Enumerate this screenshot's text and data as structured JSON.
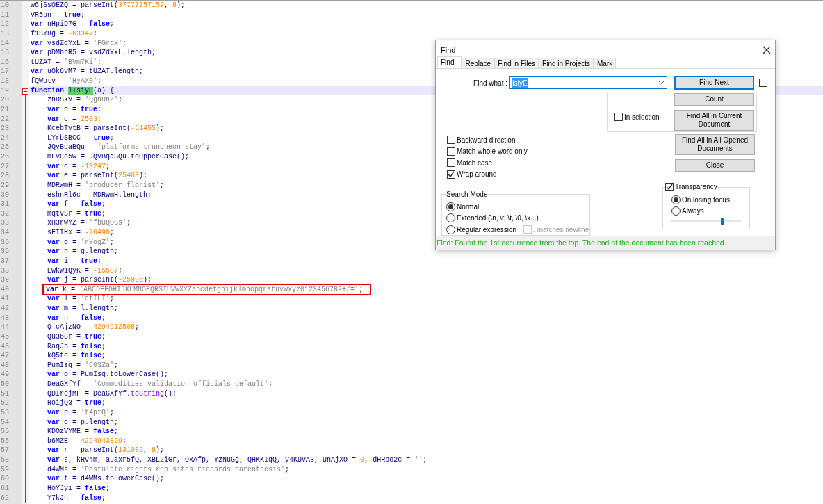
{
  "editor": {
    "lines": [
      {
        "no": "10",
        "current": false,
        "boxed": false,
        "tokens": [
          {
            "kind": "plain",
            "text": "w6jSsQEZQ = parseInt("
          },
          {
            "kind": "number",
            "text": "37777757152"
          },
          {
            "kind": "plain",
            "text": ", "
          },
          {
            "kind": "number",
            "text": "8"
          },
          {
            "kind": "plain",
            "text": ");"
          }
        ]
      },
      {
        "no": "11",
        "current": false,
        "boxed": false,
        "tokens": [
          {
            "kind": "plain",
            "text": "VR5pn = "
          },
          {
            "kind": "keyword",
            "text": "true"
          },
          {
            "kind": "plain",
            "text": ";"
          }
        ]
      },
      {
        "no": "12",
        "current": false,
        "boxed": false,
        "tokens": [
          {
            "kind": "keyword",
            "text": "var"
          },
          {
            "kind": "plain",
            "text": " nHpiD7G = "
          },
          {
            "kind": "keyword",
            "text": "false"
          },
          {
            "kind": "plain",
            "text": ";"
          }
        ]
      },
      {
        "no": "13",
        "current": false,
        "boxed": false,
        "tokens": [
          {
            "kind": "plain",
            "text": "f1SY8g = "
          },
          {
            "kind": "number",
            "text": "-63347"
          },
          {
            "kind": "plain",
            "text": ";"
          }
        ]
      },
      {
        "no": "14",
        "current": false,
        "boxed": false,
        "tokens": [
          {
            "kind": "keyword",
            "text": "var"
          },
          {
            "kind": "plain",
            "text": " vsdZdYxL = "
          },
          {
            "kind": "string",
            "text": "'FGrdX'"
          },
          {
            "kind": "plain",
            "text": ";"
          }
        ]
      },
      {
        "no": "15",
        "current": false,
        "boxed": false,
        "tokens": [
          {
            "kind": "keyword",
            "text": "var"
          },
          {
            "kind": "plain",
            "text": " pDMbnR5 = vsdZdYxL.length;"
          }
        ]
      },
      {
        "no": "16",
        "current": false,
        "boxed": false,
        "tokens": [
          {
            "kind": "plain",
            "text": "tUZAT = "
          },
          {
            "kind": "string",
            "text": "'BVm7Ki'"
          },
          {
            "kind": "plain",
            "text": ";"
          }
        ]
      },
      {
        "no": "17",
        "current": false,
        "boxed": false,
        "tokens": [
          {
            "kind": "keyword",
            "text": "var"
          },
          {
            "kind": "plain",
            "text": " uQk6vM7 = tUZAT.length;"
          }
        ]
      },
      {
        "no": "18",
        "current": false,
        "boxed": false,
        "tokens": [
          {
            "kind": "plain",
            "text": "fQWbtv = "
          },
          {
            "kind": "string",
            "text": "'HyAX0'"
          },
          {
            "kind": "plain",
            "text": ";"
          }
        ]
      },
      {
        "no": "19",
        "current": true,
        "boxed": false,
        "expanded": true,
        "tokens": [
          {
            "kind": "keyword",
            "text": "function "
          },
          {
            "kind": "match",
            "text": "lIsiyE"
          },
          {
            "kind": "plain",
            "text": "(a) {"
          }
        ],
        "children": [
          {
            "no": "20",
            "current": false,
            "boxed": false,
            "tokens": [
              {
                "kind": "plain",
                "text": "znDSkv = "
              },
              {
                "kind": "string",
                "text": "'QgnDnZ'"
              },
              {
                "kind": "plain",
                "text": ";"
              }
            ]
          },
          {
            "no": "21",
            "current": false,
            "boxed": false,
            "tokens": [
              {
                "kind": "keyword",
                "text": "var"
              },
              {
                "kind": "plain",
                "text": " b = "
              },
              {
                "kind": "keyword",
                "text": "true"
              },
              {
                "kind": "plain",
                "text": ";"
              }
            ]
          },
          {
            "no": "22",
            "current": false,
            "boxed": false,
            "tokens": [
              {
                "kind": "keyword",
                "text": "var"
              },
              {
                "kind": "plain",
                "text": " c = "
              },
              {
                "kind": "number",
                "text": "2503"
              },
              {
                "kind": "plain",
                "text": ";"
              }
            ]
          },
          {
            "no": "23",
            "current": false,
            "boxed": false,
            "tokens": [
              {
                "kind": "plain",
                "text": "KcebTvtB = parseInt("
              },
              {
                "kind": "number",
                "text": "-51455"
              },
              {
                "kind": "plain",
                "text": ");"
              }
            ]
          },
          {
            "no": "24",
            "current": false,
            "boxed": false,
            "tokens": [
              {
                "kind": "plain",
                "text": "LYrbSBCC = "
              },
              {
                "kind": "keyword",
                "text": "true"
              },
              {
                "kind": "plain",
                "text": ";"
              }
            ]
          },
          {
            "no": "25",
            "current": false,
            "boxed": false,
            "tokens": [
              {
                "kind": "plain",
                "text": "JQvBqaBQu = "
              },
              {
                "kind": "string",
                "text": "'platforms truncheon stay'"
              },
              {
                "kind": "plain",
                "text": ";"
              }
            ]
          },
          {
            "no": "26",
            "current": false,
            "boxed": false,
            "tokens": [
              {
                "kind": "plain",
                "text": "mLvCd5w = JQvBqaBQu.toUpperCase();"
              }
            ]
          },
          {
            "no": "27",
            "current": false,
            "boxed": false,
            "tokens": [
              {
                "kind": "keyword",
                "text": "var"
              },
              {
                "kind": "plain",
                "text": " d = "
              },
              {
                "kind": "number",
                "text": "-13247"
              },
              {
                "kind": "plain",
                "text": ";"
              }
            ]
          },
          {
            "no": "28",
            "current": false,
            "boxed": false,
            "tokens": [
              {
                "kind": "keyword",
                "text": "var"
              },
              {
                "kind": "plain",
                "text": " e = parseInt("
              },
              {
                "kind": "number",
                "text": "25463"
              },
              {
                "kind": "plain",
                "text": ");"
              }
            ]
          },
          {
            "no": "29",
            "current": false,
            "boxed": false,
            "tokens": [
              {
                "kind": "plain",
                "text": "MDRwmH = "
              },
              {
                "kind": "string",
                "text": "'producer florist'"
              },
              {
                "kind": "plain",
                "text": ";"
              }
            ]
          },
          {
            "no": "30",
            "current": false,
            "boxed": false,
            "tokens": [
              {
                "kind": "plain",
                "text": "eshnRl6c = MDRwmH.length;"
              }
            ]
          },
          {
            "no": "31",
            "current": false,
            "boxed": false,
            "tokens": [
              {
                "kind": "keyword",
                "text": "var"
              },
              {
                "kind": "plain",
                "text": " f = "
              },
              {
                "kind": "keyword",
                "text": "false"
              },
              {
                "kind": "plain",
                "text": ";"
              }
            ]
          },
          {
            "no": "32",
            "current": false,
            "boxed": false,
            "tokens": [
              {
                "kind": "plain",
                "text": "mqtVSr = "
              },
              {
                "kind": "keyword",
                "text": "true"
              },
              {
                "kind": "plain",
                "text": ";"
              }
            ]
          },
          {
            "no": "33",
            "current": false,
            "boxed": false,
            "tokens": [
              {
                "kind": "plain",
                "text": "xH3rwYZ = "
              },
              {
                "kind": "string",
                "text": "'fbUQOGs'"
              },
              {
                "kind": "plain",
                "text": ";"
              }
            ]
          },
          {
            "no": "34",
            "current": false,
            "boxed": false,
            "tokens": [
              {
                "kind": "plain",
                "text": "sFIIHx = "
              },
              {
                "kind": "number",
                "text": "-26490"
              },
              {
                "kind": "plain",
                "text": ";"
              }
            ]
          },
          {
            "no": "35",
            "current": false,
            "boxed": false,
            "tokens": [
              {
                "kind": "keyword",
                "text": "var"
              },
              {
                "kind": "plain",
                "text": " g = "
              },
              {
                "kind": "string",
                "text": "'rYogZ'"
              },
              {
                "kind": "plain",
                "text": ";"
              }
            ]
          },
          {
            "no": "36",
            "current": false,
            "boxed": false,
            "tokens": [
              {
                "kind": "keyword",
                "text": "var"
              },
              {
                "kind": "plain",
                "text": " h = g.length;"
              }
            ]
          },
          {
            "no": "37",
            "current": false,
            "boxed": false,
            "tokens": [
              {
                "kind": "keyword",
                "text": "var"
              },
              {
                "kind": "plain",
                "text": " i = "
              },
              {
                "kind": "keyword",
                "text": "true"
              },
              {
                "kind": "plain",
                "text": ";"
              }
            ]
          },
          {
            "no": "38",
            "current": false,
            "boxed": false,
            "tokens": [
              {
                "kind": "plain",
                "text": "EwkW1QyK = "
              },
              {
                "kind": "number",
                "text": "-15507"
              },
              {
                "kind": "plain",
                "text": ";"
              }
            ]
          },
          {
            "no": "39",
            "current": false,
            "boxed": false,
            "tokens": [
              {
                "kind": "keyword",
                "text": "var"
              },
              {
                "kind": "plain",
                "text": " j = parseInt("
              },
              {
                "kind": "number",
                "text": "-25906"
              },
              {
                "kind": "plain",
                "text": ");"
              }
            ]
          },
          {
            "no": "40",
            "current": false,
            "boxed": true,
            "tokens": [
              {
                "kind": "keyword",
                "text": "var"
              },
              {
                "kind": "plain",
                "text": " k = "
              },
              {
                "kind": "string",
                "text": "'ABCDEFGHIJKLMNOPQRSTUVWXYZabcdefghijklmnopqrstuvwxyz0123456789+/='"
              },
              {
                "kind": "plain",
                "text": ";"
              }
            ]
          },
          {
            "no": "41",
            "current": false,
            "boxed": false,
            "tokens": [
              {
                "kind": "keyword",
                "text": "var"
              },
              {
                "kind": "plain",
                "text": " l = "
              },
              {
                "kind": "string",
                "text": "'afILI'"
              },
              {
                "kind": "plain",
                "text": ";"
              }
            ]
          },
          {
            "no": "42",
            "current": false,
            "boxed": false,
            "tokens": [
              {
                "kind": "keyword",
                "text": "var"
              },
              {
                "kind": "plain",
                "text": " m = l.length;"
              }
            ]
          },
          {
            "no": "43",
            "current": false,
            "boxed": false,
            "tokens": [
              {
                "kind": "keyword",
                "text": "var"
              },
              {
                "kind": "plain",
                "text": " n = "
              },
              {
                "kind": "keyword",
                "text": "false"
              },
              {
                "kind": "plain",
                "text": ";"
              }
            ]
          },
          {
            "no": "44",
            "current": false,
            "boxed": false,
            "tokens": [
              {
                "kind": "plain",
                "text": "QjcAjzNO = "
              },
              {
                "kind": "number",
                "text": "4294912508"
              },
              {
                "kind": "plain",
                "text": ";"
              }
            ]
          },
          {
            "no": "45",
            "current": false,
            "boxed": false,
            "tokens": [
              {
                "kind": "plain",
                "text": "Qu368r = "
              },
              {
                "kind": "keyword",
                "text": "true"
              },
              {
                "kind": "plain",
                "text": ";"
              }
            ]
          },
          {
            "no": "46",
            "current": false,
            "boxed": false,
            "tokens": [
              {
                "kind": "plain",
                "text": "RaqJb = "
              },
              {
                "kind": "keyword",
                "text": "false"
              },
              {
                "kind": "plain",
                "text": ";"
              }
            ]
          },
          {
            "no": "47",
            "current": false,
            "boxed": false,
            "tokens": [
              {
                "kind": "plain",
                "text": "kQ5td = "
              },
              {
                "kind": "keyword",
                "text": "false"
              },
              {
                "kind": "plain",
                "text": ";"
              }
            ]
          },
          {
            "no": "48",
            "current": false,
            "boxed": false,
            "tokens": [
              {
                "kind": "plain",
                "text": "PumIsq = "
              },
              {
                "kind": "string",
                "text": "'C0SZa'"
              },
              {
                "kind": "plain",
                "text": ";"
              }
            ]
          },
          {
            "no": "49",
            "current": false,
            "boxed": false,
            "tokens": [
              {
                "kind": "keyword",
                "text": "var"
              },
              {
                "kind": "plain",
                "text": " o = PumIsq.toLowerCase();"
              }
            ]
          },
          {
            "no": "50",
            "current": false,
            "boxed": false,
            "tokens": [
              {
                "kind": "plain",
                "text": "DeaGXfYf = "
              },
              {
                "kind": "string",
                "text": "'Commodities validation officials default'"
              },
              {
                "kind": "plain",
                "text": ";"
              }
            ]
          },
          {
            "no": "51",
            "current": false,
            "boxed": false,
            "tokens": [
              {
                "kind": "plain",
                "text": "QDIrejMF = DeaGXfYf."
              },
              {
                "kind": "method",
                "text": "toString"
              },
              {
                "kind": "plain",
                "text": "();"
              }
            ]
          },
          {
            "no": "52",
            "current": false,
            "boxed": false,
            "tokens": [
              {
                "kind": "plain",
                "text": "RoijQ3 = "
              },
              {
                "kind": "keyword",
                "text": "true"
              },
              {
                "kind": "plain",
                "text": ";"
              }
            ]
          },
          {
            "no": "53",
            "current": false,
            "boxed": false,
            "tokens": [
              {
                "kind": "keyword",
                "text": "var"
              },
              {
                "kind": "plain",
                "text": " p = "
              },
              {
                "kind": "string",
                "text": "'t4ptQ'"
              },
              {
                "kind": "plain",
                "text": ";"
              }
            ]
          },
          {
            "no": "54",
            "current": false,
            "boxed": false,
            "tokens": [
              {
                "kind": "keyword",
                "text": "var"
              },
              {
                "kind": "plain",
                "text": " q = p.length;"
              }
            ]
          },
          {
            "no": "55",
            "current": false,
            "boxed": false,
            "tokens": [
              {
                "kind": "plain",
                "text": "KDOzVYME = "
              },
              {
                "kind": "keyword",
                "text": "false"
              },
              {
                "kind": "plain",
                "text": ";"
              }
            ]
          },
          {
            "no": "56",
            "current": false,
            "boxed": false,
            "tokens": [
              {
                "kind": "plain",
                "text": "b6MZE = "
              },
              {
                "kind": "number",
                "text": "4294943829"
              },
              {
                "kind": "plain",
                "text": ";"
              }
            ]
          },
          {
            "no": "57",
            "current": false,
            "boxed": false,
            "tokens": [
              {
                "kind": "keyword",
                "text": "var"
              },
              {
                "kind": "plain",
                "text": " r = parseInt("
              },
              {
                "kind": "number",
                "text": "131032"
              },
              {
                "kind": "plain",
                "text": ", "
              },
              {
                "kind": "number",
                "text": "8"
              },
              {
                "kind": "plain",
                "text": ");"
              }
            ]
          },
          {
            "no": "58",
            "current": false,
            "boxed": false,
            "tokens": [
              {
                "kind": "keyword",
                "text": "var"
              },
              {
                "kind": "plain",
                "text": " s, kRv4m, auaxr5fQ, XBL2iGr, OxAfp, YzNuGg, QHKKIqQ, y4KUvA3, UnAjXO = "
              },
              {
                "kind": "number",
                "text": "0"
              },
              {
                "kind": "plain",
                "text": ", dHRpo2c = "
              },
              {
                "kind": "string",
                "text": "''"
              },
              {
                "kind": "plain",
                "text": ";"
              }
            ]
          },
          {
            "no": "59",
            "current": false,
            "boxed": false,
            "tokens": [
              {
                "kind": "plain",
                "text": "d4WMs = "
              },
              {
                "kind": "string",
                "text": "'Postulate rights rep sites richards parenthesis'"
              },
              {
                "kind": "plain",
                "text": ";"
              }
            ]
          },
          {
            "no": "60",
            "current": false,
            "boxed": false,
            "tokens": [
              {
                "kind": "keyword",
                "text": "var"
              },
              {
                "kind": "plain",
                "text": " t = d4WMs.toLowerCase();"
              }
            ]
          },
          {
            "no": "61",
            "current": false,
            "boxed": false,
            "tokens": [
              {
                "kind": "plain",
                "text": "HoYJyi = "
              },
              {
                "kind": "keyword",
                "text": "false"
              },
              {
                "kind": "plain",
                "text": ";"
              }
            ]
          },
          {
            "no": "62",
            "current": false,
            "boxed": false,
            "tokens": [
              {
                "kind": "plain",
                "text": "Y7kJn = "
              },
              {
                "kind": "keyword",
                "text": "false"
              },
              {
                "kind": "plain",
                "text": ";"
              }
            ]
          }
        ]
      }
    ]
  },
  "find_dialog": {
    "title": "Find",
    "tabs": [
      {
        "label": "Find",
        "selected": true
      },
      {
        "label": "Replace",
        "selected": false
      },
      {
        "label": "Find in Files",
        "selected": false
      },
      {
        "label": "Find in Projects",
        "selected": false
      },
      {
        "label": "Mark",
        "selected": false
      }
    ],
    "find_what": {
      "label": "Find what :",
      "value": "IsiyE"
    },
    "side_checkbox": {
      "checked": false
    },
    "in_selection": {
      "label": "In selection",
      "checked": false
    },
    "buttons": [
      {
        "label": "Find Next",
        "default": true
      },
      {
        "label": "Count",
        "default": false
      },
      {
        "label": "Find All in Current Document",
        "default": false
      },
      {
        "label": "Find All in All Opened Documents",
        "default": false
      },
      {
        "label": "Close",
        "default": false
      }
    ],
    "options": [
      {
        "label": "Backward direction",
        "checked": false
      },
      {
        "label": "Match whole word only",
        "checked": false
      },
      {
        "label": "Match case",
        "checked": false
      },
      {
        "label": "Wrap around",
        "checked": true
      }
    ],
    "search_mode": {
      "title": "Search Mode",
      "modes": [
        {
          "label": "Normal",
          "selected": true
        },
        {
          "label": "Extended (\\n, \\r, \\t, \\0, \\x...)",
          "selected": false
        },
        {
          "label": "Regular expression",
          "selected": false
        }
      ],
      "dot_newline": {
        "label": ". matches newline",
        "checked": false,
        "disabled": true
      }
    },
    "transparency": {
      "label": "Transparency",
      "checked": true,
      "modes": [
        {
          "label": "On losing focus",
          "selected": true
        },
        {
          "label": "Always",
          "selected": false
        }
      ],
      "slider": {
        "level": 0.71
      }
    },
    "status": "Find: Found the 1st occurrence from the top. The end of the document has been reached."
  }
}
